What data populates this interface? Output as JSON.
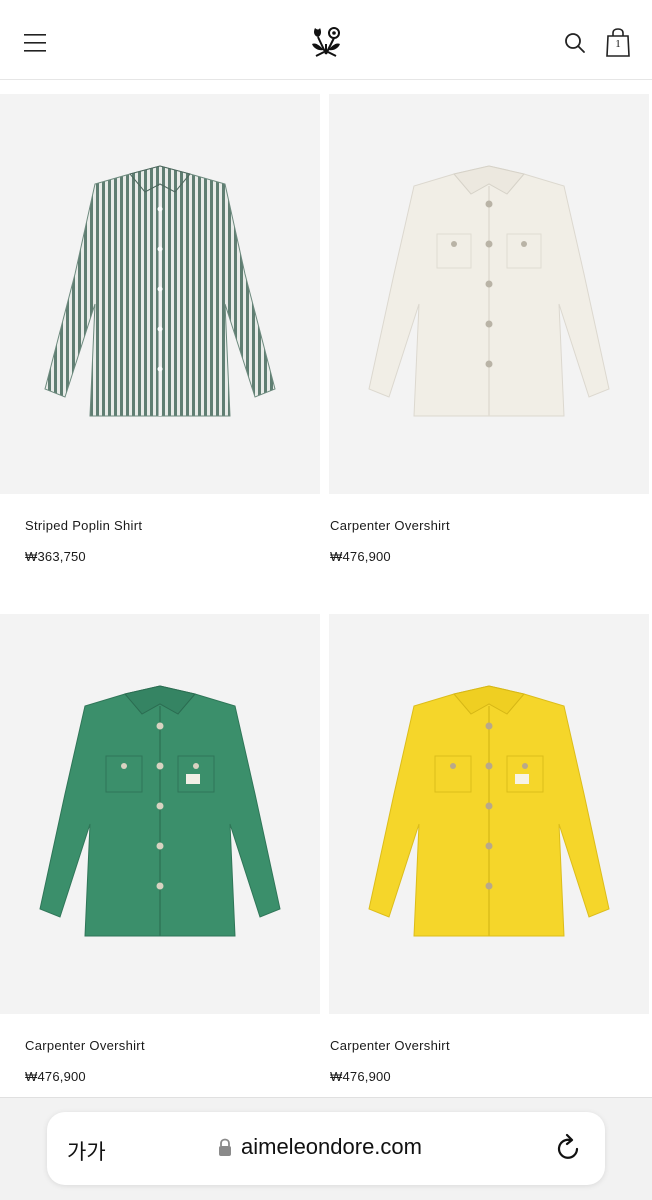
{
  "header": {
    "cart_count": "1"
  },
  "products": [
    {
      "name": "Striped Poplin Shirt",
      "price": "₩363,750",
      "color": "#5f7e72"
    },
    {
      "name": "Carpenter Overshirt",
      "price": "₩476,900",
      "color": "#f1eee6"
    },
    {
      "name": "Carpenter Overshirt",
      "price": "₩476,900",
      "color": "#3b8f6b"
    },
    {
      "name": "Carpenter Overshirt",
      "price": "₩476,900",
      "color": "#f5d62a"
    }
  ],
  "browser": {
    "text_size_label": "가가",
    "url": "aimeleondore.com"
  }
}
